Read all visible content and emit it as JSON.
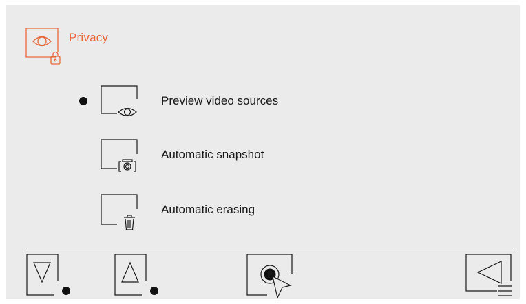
{
  "header": {
    "title": "Privacy",
    "icon": "privacy-eye-lock-icon",
    "accent_color": "#e8693c"
  },
  "menu": {
    "items": [
      {
        "label": "Preview video sources",
        "icon": "eye-icon",
        "selected": true
      },
      {
        "label": "Automatic snapshot",
        "icon": "camera-icon",
        "selected": false
      },
      {
        "label": "Automatic erasing",
        "icon": "trash-icon",
        "selected": false
      }
    ]
  },
  "footer": {
    "buttons": [
      {
        "name": "scroll-down-button",
        "icon": "triangle-down-icon"
      },
      {
        "name": "scroll-up-button",
        "icon": "triangle-up-icon"
      },
      {
        "name": "select-button",
        "icon": "select-cursor-icon"
      },
      {
        "name": "back-button",
        "icon": "back-menu-icon"
      }
    ]
  }
}
